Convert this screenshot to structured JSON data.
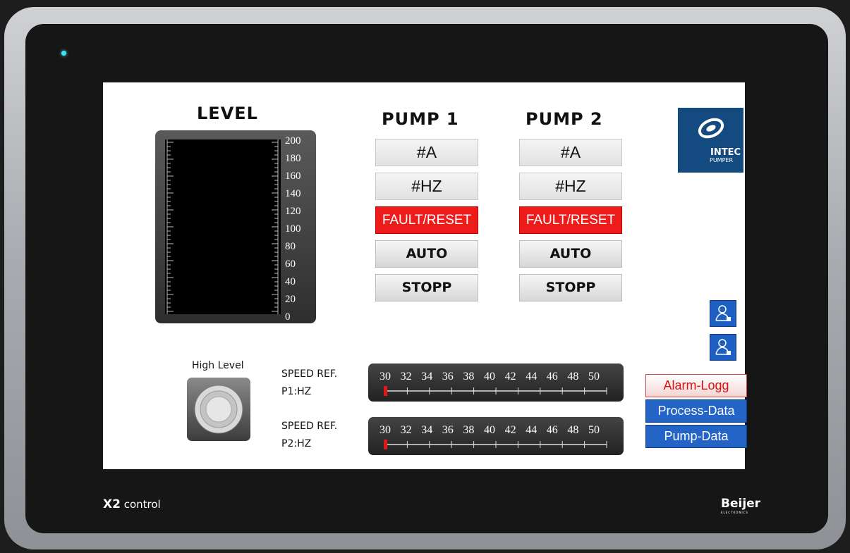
{
  "device": {
    "brand_left_bold": "X2",
    "brand_left_rest": "control",
    "brand_right": "Beijer",
    "brand_right_sub": "ELECTRONICS"
  },
  "level": {
    "title": "LEVEL",
    "scale": [
      "200",
      "180",
      "160",
      "140",
      "120",
      "100",
      "80",
      "60",
      "40",
      "20",
      "0"
    ]
  },
  "pump1": {
    "title": "PUMP 1",
    "current": "#A",
    "frequency": "#HZ",
    "fault_reset": "FAULT/RESET",
    "auto": "AUTO",
    "stop": "STOPP"
  },
  "pump2": {
    "title": "PUMP 2",
    "current": "#A",
    "frequency": "#HZ",
    "fault_reset": "FAULT/RESET",
    "auto": "AUTO",
    "stop": "STOPP"
  },
  "logo": {
    "line1": "INTEC",
    "line2": "PUMPER"
  },
  "high_level": {
    "label": "High Level"
  },
  "speed_ref": {
    "p1_line1": "SPEED REF.",
    "p1_line2": "P1:HZ",
    "p2_line1": "SPEED REF.",
    "p2_line2": "P2:HZ",
    "ticks": [
      "30",
      "32",
      "34",
      "36",
      "38",
      "40",
      "42",
      "44",
      "46",
      "48",
      "50"
    ],
    "p1_value": 30,
    "p2_value": 30
  },
  "nav": {
    "alarm_log": "Alarm-Logg",
    "process_data": "Process-Data",
    "pump_data": "Pump-Data"
  },
  "colors": {
    "fault": "#ee1b1b",
    "nav_blue": "#2564c7",
    "logo_blue": "#134a80",
    "led": "#3fe2f5"
  }
}
